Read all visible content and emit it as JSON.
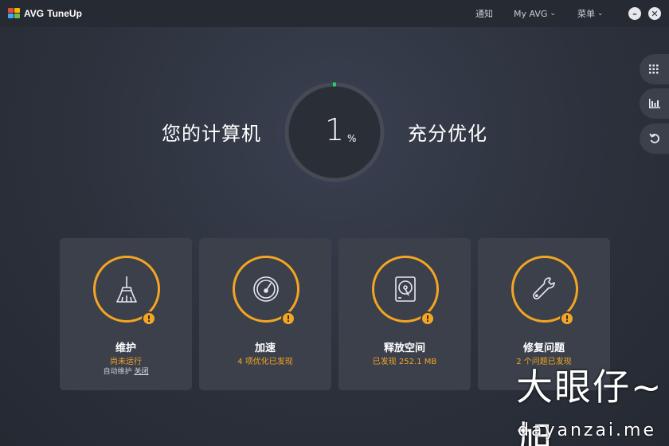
{
  "app": {
    "brand": "AVG",
    "product": "TuneUp"
  },
  "nav": {
    "notify": "通知",
    "myavg": "My AVG",
    "menu": "菜单"
  },
  "window": {
    "minimize": "–",
    "close": "✕"
  },
  "sidebar": {
    "items": [
      {
        "icon": "grid-icon"
      },
      {
        "icon": "bar-chart-icon"
      },
      {
        "icon": "undo-icon"
      }
    ]
  },
  "hero": {
    "left_text": "您的计算机",
    "right_text": "充分优化",
    "progress_value": "1",
    "progress_unit": "%",
    "progress_fraction": 0.01
  },
  "cards": [
    {
      "title": "维护",
      "status": "尚未运行",
      "sub_text": "自动维护",
      "sub_link": "关闭",
      "icon": "broom-icon",
      "badge": "!"
    },
    {
      "title": "加速",
      "status": "4 项优化已发现",
      "icon": "speedometer-icon",
      "badge": "!"
    },
    {
      "title": "释放空间",
      "status": "已发现 252.1 MB",
      "icon": "hard-drive-icon",
      "badge": "!"
    },
    {
      "title": "修复问题",
      "status": "2 个问题已发现",
      "icon": "wrench-icon",
      "badge": "!"
    }
  ],
  "watermark": {
    "cn": "大眼仔~旭",
    "url": "dayanzai.me"
  },
  "colors": {
    "accent": "#f4a522",
    "progress": "#2ecc71",
    "card_bg": "#3b404b",
    "titlebar": "#262a32"
  }
}
